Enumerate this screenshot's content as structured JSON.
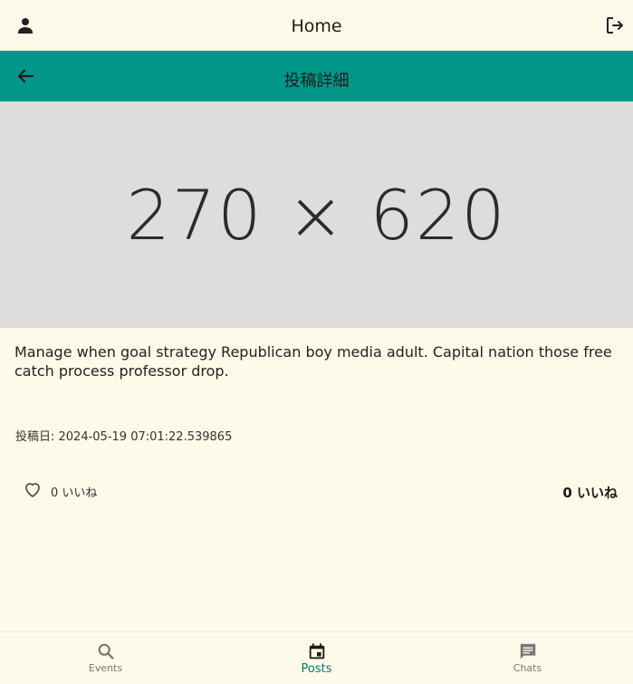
{
  "header": {
    "title": "Home",
    "profile_icon": "person-icon",
    "logout_icon": "logout-icon"
  },
  "subheader": {
    "title": "投稿詳細",
    "back_icon": "arrow-back-icon",
    "color": "#009788"
  },
  "post": {
    "image_placeholder": "270 × 620",
    "body": "Manage when goal strategy Republican boy media adult. Capital nation those free catch process professor drop.",
    "posted_at": "投稿日: 2024-05-19 07:01:22.539865",
    "like_label": "0 いいね",
    "like_count_label": "0 いいね"
  },
  "bottom_nav": {
    "items": [
      {
        "label": "Events",
        "icon": "search-icon",
        "active": false
      },
      {
        "label": "Posts",
        "icon": "event-icon",
        "active": true
      },
      {
        "label": "Chats",
        "icon": "chat-icon",
        "active": false
      }
    ],
    "active_color": "#007c6e"
  }
}
